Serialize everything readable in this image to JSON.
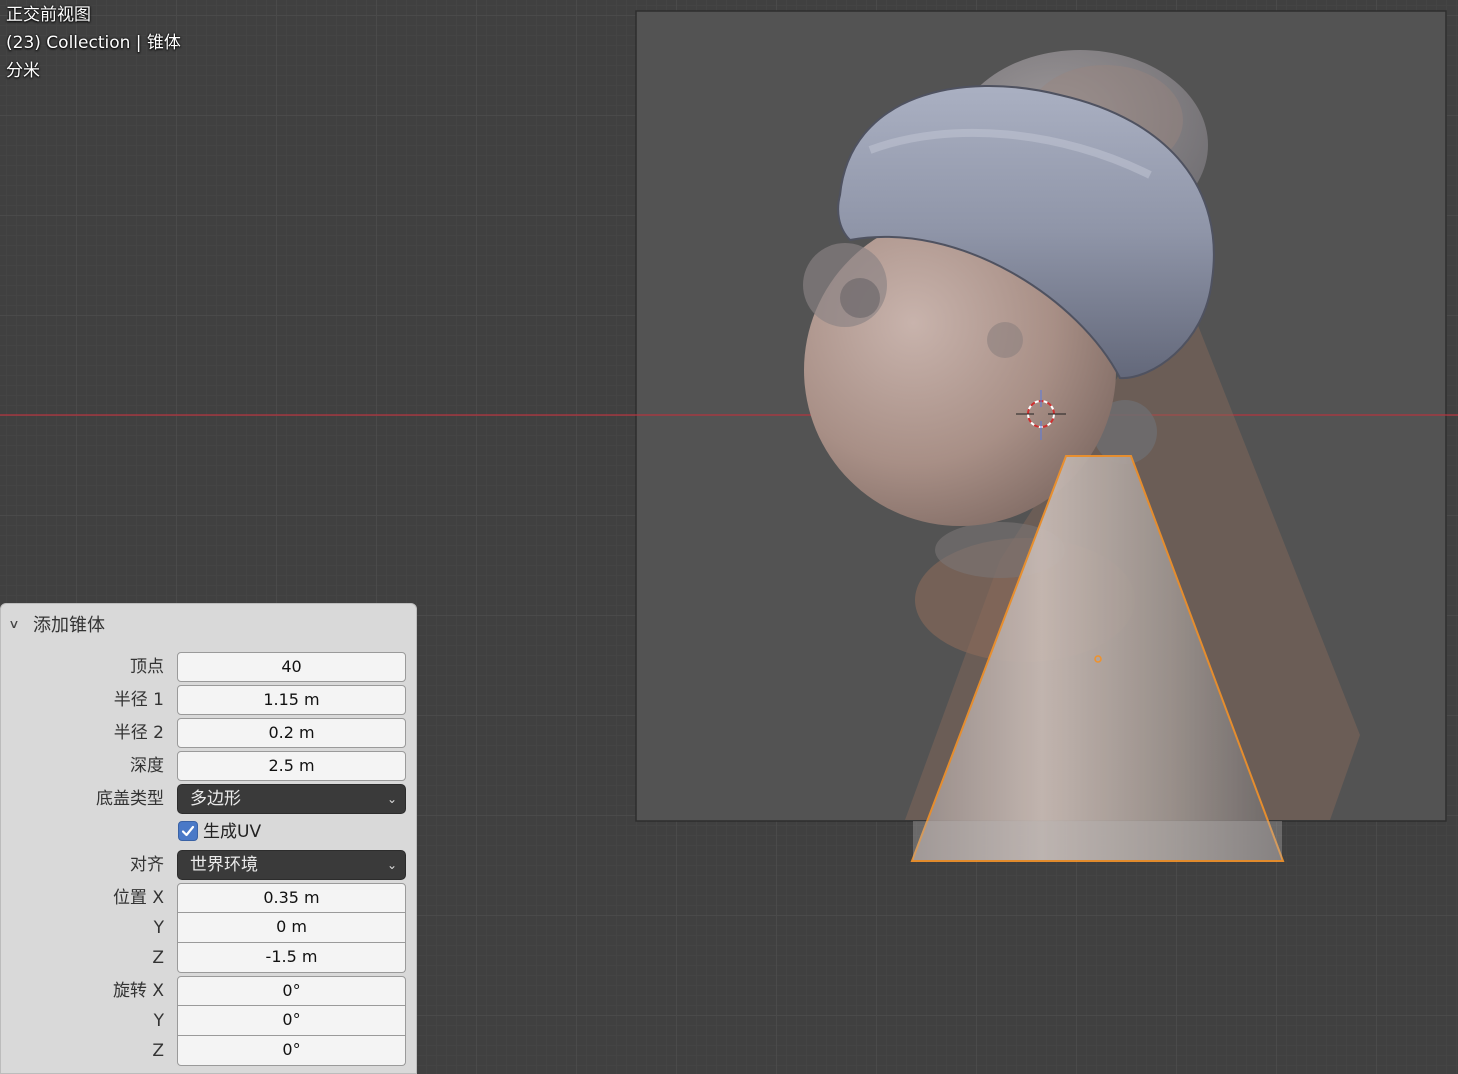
{
  "viewport": {
    "view_name": "正交前视图",
    "collection_info": "(23) Collection | 锥体",
    "units": "分米"
  },
  "operator_panel": {
    "title": "添加锥体",
    "vertices": {
      "label": "顶点",
      "value": "40"
    },
    "radius1": {
      "label": "半径 1",
      "value": "1.15 m"
    },
    "radius2": {
      "label": "半径 2",
      "value": "0.2 m"
    },
    "depth": {
      "label": "深度",
      "value": "2.5 m"
    },
    "base_fill_type": {
      "label": "底盖类型",
      "value": "多边形"
    },
    "generate_uv": {
      "label": "生成UV",
      "checked": true
    },
    "align": {
      "label": "对齐",
      "value": "世界环境"
    },
    "location": {
      "label": "位置 X",
      "x": "0.35 m",
      "y_label": "Y",
      "y": "0 m",
      "z_label": "Z",
      "z": "-1.5 m"
    },
    "rotation": {
      "label": "旋转 X",
      "x": "0°",
      "y_label": "Y",
      "y": "0°",
      "z_label": "Z",
      "z": "0°"
    }
  },
  "colors": {
    "selection_outline": "#f0922b",
    "x_axis": "#b3343f",
    "checkbox": "#4a79c7"
  },
  "icons": {
    "panel_toggle": "chevron-down-icon",
    "cursor": "3d-cursor-icon",
    "checkbox": "checkmark-icon"
  }
}
